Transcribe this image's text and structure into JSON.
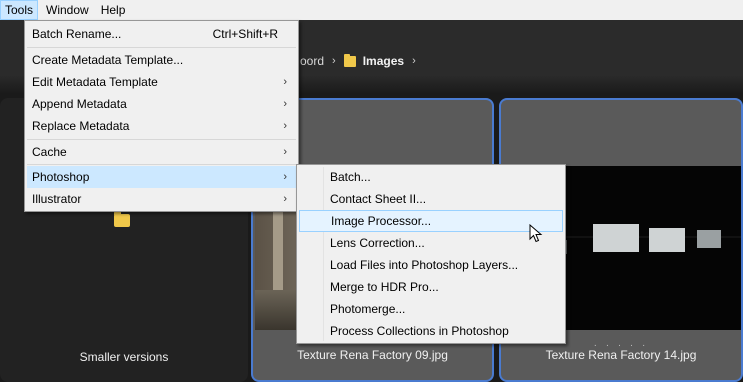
{
  "menubar": {
    "items": [
      {
        "label": "Tools",
        "active": true
      },
      {
        "label": "Window",
        "active": false
      },
      {
        "label": "Help",
        "active": false
      }
    ]
  },
  "breadcrumb": {
    "prev_fragment": "oord",
    "current": "Images"
  },
  "tools_menu": {
    "items": [
      {
        "label": "Batch Rename...",
        "shortcut": "Ctrl+Shift+R"
      },
      {
        "label": "Create Metadata Template..."
      },
      {
        "label": "Edit Metadata Template",
        "submenu": true
      },
      {
        "label": "Append Metadata",
        "submenu": true
      },
      {
        "label": "Replace Metadata",
        "submenu": true
      },
      {
        "label": "Cache",
        "submenu": true
      },
      {
        "label": "Photoshop",
        "submenu": true,
        "highlighted": true
      },
      {
        "label": "Illustrator",
        "submenu": true
      }
    ]
  },
  "photoshop_submenu": {
    "items": [
      {
        "label": "Batch..."
      },
      {
        "label": "Contact Sheet II..."
      },
      {
        "label": "Image Processor...",
        "highlighted": true
      },
      {
        "label": "Lens Correction..."
      },
      {
        "label": "Load Files into Photoshop Layers..."
      },
      {
        "label": "Merge to HDR Pro..."
      },
      {
        "label": "Photomerge..."
      },
      {
        "label": "Process Collections in Photoshop"
      }
    ]
  },
  "thumbnails": [
    {
      "caption": "Smaller versions",
      "type": "folder"
    },
    {
      "caption": "Texture Rena Factory 09.jpg",
      "type": "image",
      "selected": true
    },
    {
      "caption": "Texture Rena Factory 14.jpg",
      "type": "image",
      "selected": true,
      "rating_dots": "· · · · ·"
    }
  ],
  "icons": {
    "submenu_arrow": "›",
    "breadcrumb_sep": "›"
  },
  "colors": {
    "menu_bg": "#f0f0f0",
    "highlight": "#cce8ff",
    "selection_border": "#4a7bd0",
    "folder": "#f0c84a"
  }
}
